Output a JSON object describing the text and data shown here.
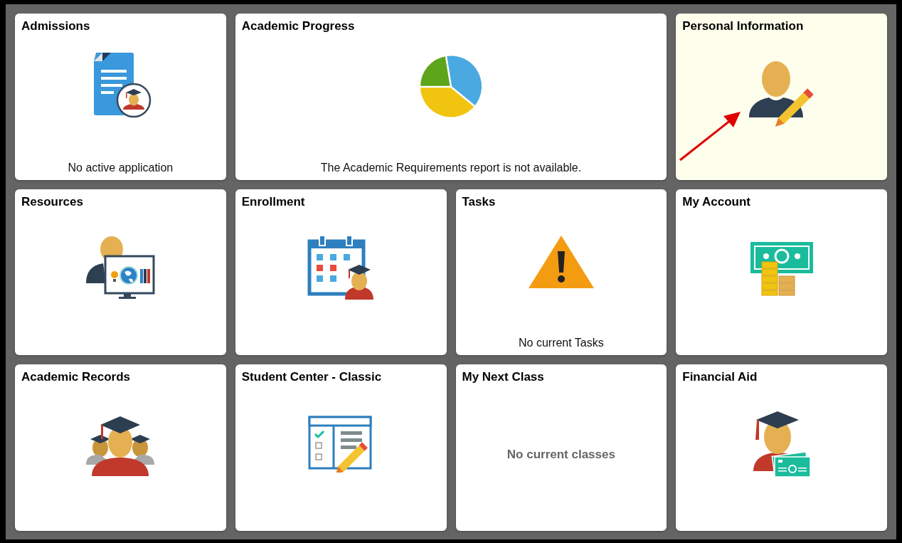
{
  "tiles": [
    {
      "title": "Admissions",
      "wide": false,
      "highlighted": false,
      "message": {
        "text": "No active application",
        "kind": "footer"
      }
    },
    {
      "title": "Academic Progress",
      "wide": true,
      "highlighted": false,
      "message": {
        "text": "The Academic Requirements report is not available.",
        "kind": "footer"
      }
    },
    {
      "title": "Personal Information",
      "wide": false,
      "highlighted": true,
      "pointer_arrow": true
    },
    {
      "title": "Resources",
      "wide": false,
      "highlighted": false
    },
    {
      "title": "Enrollment",
      "wide": false,
      "highlighted": false
    },
    {
      "title": "Tasks",
      "wide": false,
      "highlighted": false,
      "message": {
        "text": "No current Tasks",
        "kind": "footer"
      }
    },
    {
      "title": "My Account",
      "wide": false,
      "highlighted": false
    },
    {
      "title": "Academic Records",
      "wide": false,
      "highlighted": false
    },
    {
      "title": "Student Center - Classic",
      "wide": false,
      "highlighted": false
    },
    {
      "title": "My Next Class",
      "wide": false,
      "highlighted": false,
      "message": {
        "text": "No current classes",
        "kind": "center"
      }
    },
    {
      "title": "Financial Aid",
      "wide": false,
      "highlighted": false
    }
  ]
}
